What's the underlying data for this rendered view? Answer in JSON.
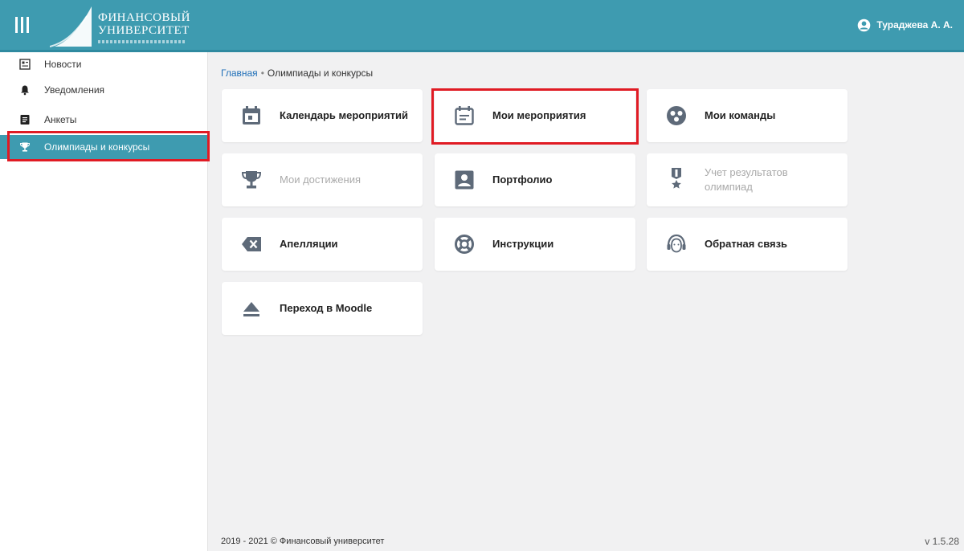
{
  "header": {
    "logo_line1": "ФИНАНСОВЫЙ",
    "logo_line2": "УНИВЕРСИТЕТ",
    "user_name": "Тураджева А. А.",
    "menu_icon": "hamburger-icon",
    "user_icon": "user-circle-icon",
    "color": "#3e9bb0"
  },
  "sidebar": {
    "items": [
      {
        "label": "Новости",
        "icon": "newspaper-icon"
      },
      {
        "label": "Уведомления",
        "icon": "bell-icon"
      },
      {
        "label": "Анкеты",
        "icon": "form-icon"
      },
      {
        "label": "Олимпиады и конкурсы",
        "icon": "trophy-icon",
        "active": true
      }
    ]
  },
  "breadcrumb": {
    "home": "Главная",
    "separator": "•",
    "current": "Олимпиады и конкурсы"
  },
  "tiles": [
    {
      "label": "Календарь мероприятий",
      "icon": "calendar-icon"
    },
    {
      "label": "Мои мероприятия",
      "icon": "event-list-icon"
    },
    {
      "label": "Мои команды",
      "icon": "team-icon"
    },
    {
      "label": "Мои достижения",
      "icon": "trophy-icon",
      "disabled": true
    },
    {
      "label": "Портфолио",
      "icon": "portfolio-icon"
    },
    {
      "label_line1": "Учет результатов",
      "label_line2": "олимпиад",
      "icon": "medal-icon",
      "disabled": true
    },
    {
      "label": "Апелляции",
      "icon": "backspace-icon"
    },
    {
      "label": "Инструкции",
      "icon": "lifebuoy-icon"
    },
    {
      "label": "Обратная связь",
      "icon": "support-agent-icon"
    },
    {
      "label": "Переход в Moodle",
      "icon": "eject-icon"
    }
  ],
  "footer": {
    "copyright": "2019 - 2021 © Финансовый университет",
    "version": "v 1.5.28"
  },
  "colors": {
    "accent": "#3e9bb0",
    "highlight": "#e01b24",
    "link": "#1f6fb8",
    "icon": "#5e6a79"
  }
}
